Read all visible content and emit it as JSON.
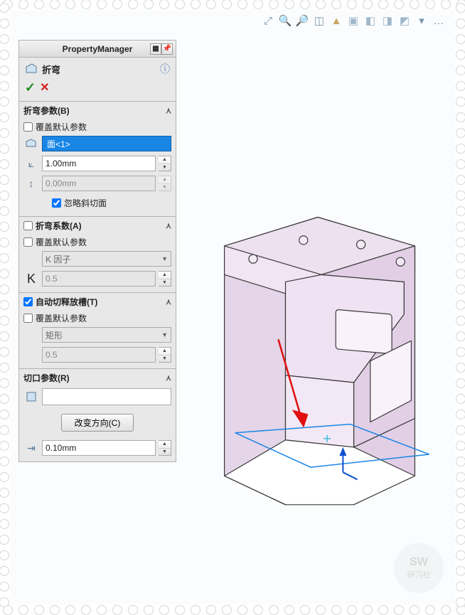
{
  "pm": {
    "title": "PropertyManager",
    "command": "折弯",
    "sections": {
      "bend_params": {
        "title": "折弯参数(B)",
        "override": "覆盖默认参数",
        "face_selection": "面<1>",
        "radius": "1.00mm",
        "offset": "0.00mm",
        "ignore_bevel": "忽略斜切面"
      },
      "bend_allowance": {
        "title": "折弯系数(A)",
        "override": "覆盖默认参数",
        "type": "K 因子",
        "k_value": "0.5"
      },
      "auto_relief": {
        "title": "自动切释放槽(T)",
        "override": "覆盖默认参数",
        "type": "矩形",
        "ratio": "0.5"
      },
      "rip_params": {
        "title": "切口参数(R)",
        "change_dir": "改变方向(C)",
        "gap": "0.10mm"
      }
    }
  },
  "watermark": {
    "line1": "SW",
    "line2": "研习社"
  }
}
